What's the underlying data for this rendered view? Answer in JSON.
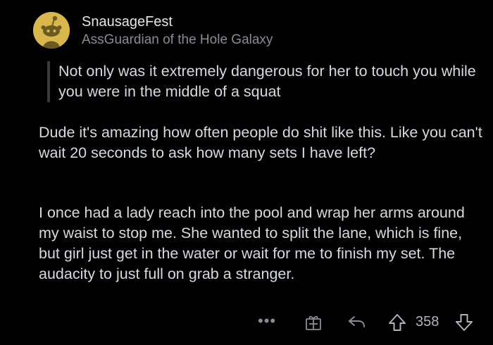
{
  "comment": {
    "username": "SnausageFest",
    "flair": "AssGuardian of the Hole Galaxy",
    "quote": "Not only was it extremely dangerous for her to touch you while you were in the middle of a squat",
    "paragraphs": [
      "Dude it's amazing how often people do shit like this. Like you can't wait 20 seconds to ask how many sets I have left?",
      "I once had a lady reach into the pool and wrap her arms around my waist to stop me. She wanted to split the lane, which is fine, but girl just get in the water or wait for me to finish my set. The audacity to just full on grab a stranger."
    ]
  },
  "actions": {
    "more_label": "•••",
    "score": "358"
  },
  "icons": {
    "avatar": "snoo-avatar-icon",
    "more": "more-options-icon",
    "award": "award-gift-icon",
    "reply": "reply-arrow-icon",
    "upvote": "upvote-arrow-icon",
    "downvote": "downvote-arrow-icon"
  },
  "colors": {
    "background": "#000000",
    "text": "#d7dadc",
    "muted": "#8a8d90",
    "avatar": "#d9b74a"
  }
}
